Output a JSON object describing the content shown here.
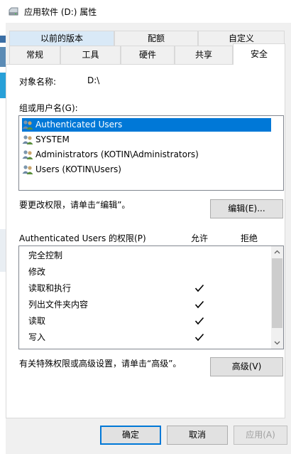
{
  "window": {
    "title": "应用软件 (D:) 属性"
  },
  "tabs_row1": [
    {
      "label": "以前的版本"
    },
    {
      "label": "配额"
    },
    {
      "label": "自定义"
    }
  ],
  "tabs_row2": [
    {
      "label": "常规"
    },
    {
      "label": "工具"
    },
    {
      "label": "硬件"
    },
    {
      "label": "共享"
    },
    {
      "label": "安全"
    }
  ],
  "security": {
    "object_label": "对象名称:",
    "object_value": "D:\\",
    "group_label": "组或用户名(G):",
    "users": [
      {
        "name": "Authenticated Users"
      },
      {
        "name": "SYSTEM"
      },
      {
        "name": "Administrators (KOTIN\\Administrators)"
      },
      {
        "name": "Users (KOTIN\\Users)"
      }
    ],
    "edit_hint": "要更改权限，请单击“编辑”。",
    "edit_button": "编辑(E)...",
    "perm_title": "Authenticated Users 的权限(P)",
    "allow_header": "允许",
    "deny_header": "拒绝",
    "permissions": [
      {
        "name": "完全控制",
        "allow": false
      },
      {
        "name": "修改",
        "allow": false
      },
      {
        "name": "读取和执行",
        "allow": true
      },
      {
        "name": "列出文件夹内容",
        "allow": true
      },
      {
        "name": "读取",
        "allow": true
      },
      {
        "name": "写入",
        "allow": true
      }
    ],
    "advanced_hint": "有关特殊权限或高级设置，请单击“高级”。",
    "advanced_button": "高级(V)"
  },
  "footer": {
    "ok": "确定",
    "cancel": "取消",
    "apply": "应用(A)"
  }
}
